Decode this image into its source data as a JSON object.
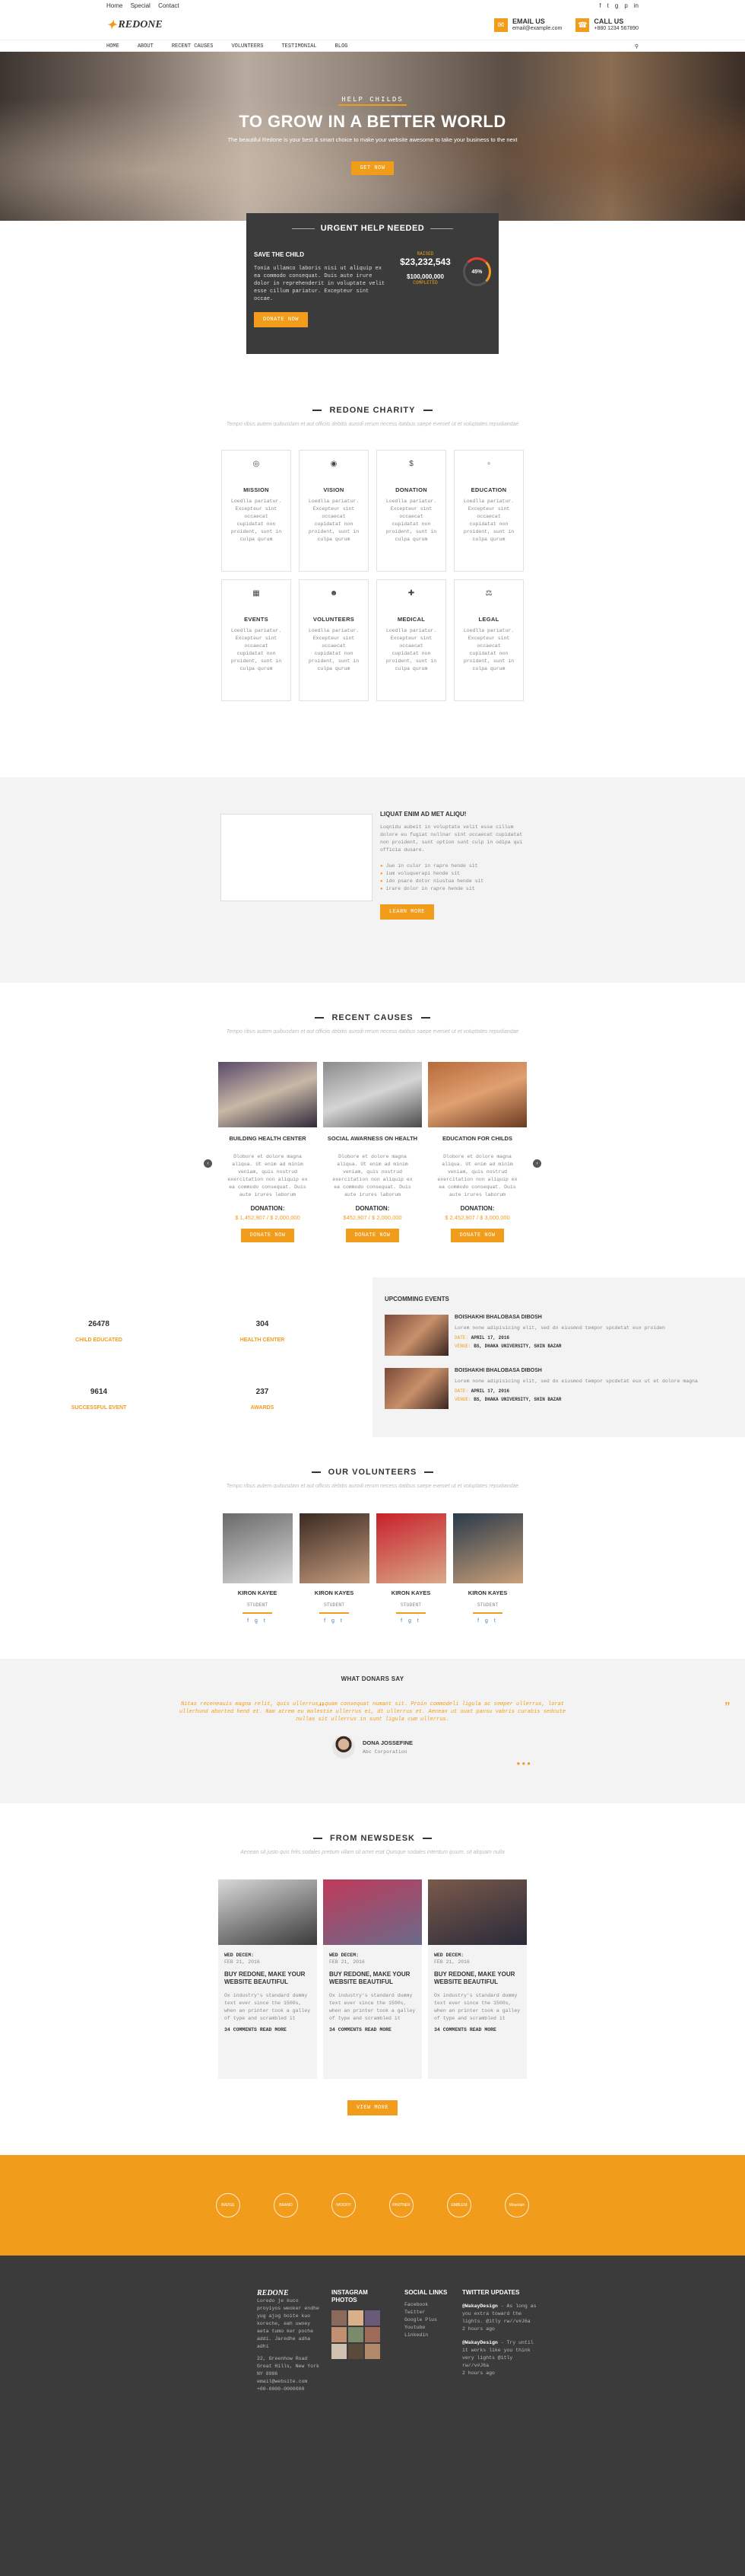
{
  "topbar": {
    "links": [
      "Home",
      "Special",
      "Contact"
    ],
    "social_icons": [
      "facebook-icon",
      "twitter-icon",
      "google-plus-icon",
      "pinterest-icon",
      "linkedin-icon"
    ]
  },
  "header": {
    "logo_text": "REDONE",
    "email_label": "EMAIL US",
    "email_value": "email@example.com",
    "call_label": "CALL US",
    "call_value": "+880 1234 567890"
  },
  "nav": {
    "items": [
      "HOME",
      "ABOUT",
      "RECENT CAUSES",
      "VOLUNTEERS",
      "TESTIMONIAL",
      "BLOG"
    ],
    "search_icon": "search-icon"
  },
  "hero": {
    "kicker": "HELP CHILDS",
    "title": "TO GROW IN A BETTER WORLD",
    "subtitle": "The beautiful Redone is your best & smart choice to make your website awesome to take your business to the next",
    "button": "GET NOW"
  },
  "urgent": {
    "title": "URGENT HELP NEEDED",
    "subject": "SAVE THE CHILD",
    "text": "Tonia ullamco laboris nisi ut aliquip ex ea commodo consequat. Duis aute irure dolor in reprehenderit in voluptate velit esse cillum pariatur. Excepteur sint occae.",
    "donate": "DONATE NOW",
    "raised_label": "RAISED",
    "raised": "$23,232,543",
    "goal": "$100,000,000",
    "goal_label": "COMPLETED",
    "progress_label": "45%",
    "progress": 0.45
  },
  "charity": {
    "title": "REDONE CHARITY",
    "subtitle": "Tempo ribus autem quibusdam et aut officiis debitis aurodi rerum necess itatibus saepe eveniet ut et voluptates repudiandae",
    "cards": [
      {
        "icon": "mission-icon",
        "title": "MISSION",
        "text": "Loedlla pariatur. Excepteur sint occaecat cupidatat non proident, sunt in culpa qurum"
      },
      {
        "icon": "eye-icon",
        "title": "VISION",
        "text": "Loedlla pariatur. Excepteur sint occaecat cupidatat non proident, sunt in culpa qurum"
      },
      {
        "icon": "dollar-icon",
        "title": "DONATION",
        "text": "Loedlla pariatur. Excepteur sint occaecat cupidatat non proident, sunt in culpa qurum"
      },
      {
        "icon": "education-icon",
        "title": "EDUCATION",
        "text": "Loedlla pariatur. Excepteur sint occaecat cupidatat non proident, sunt in culpa qurum"
      },
      {
        "icon": "calendar-icon",
        "title": "EVENTS",
        "text": "Loedlla pariatur. Excepteur sint occaecat cupidatat non proident, sunt in culpa qurum"
      },
      {
        "icon": "users-icon",
        "title": "VOLUNTEERS",
        "text": "Loedlla pariatur. Excepteur sint occaecat cupidatat non proident, sunt in culpa qurum"
      },
      {
        "icon": "medical-icon",
        "title": "MEDICAL",
        "text": "Loedlla pariatur. Excepteur sint occaecat cupidatat non proident, sunt in culpa qurum"
      },
      {
        "icon": "legal-icon",
        "title": "LEGAL",
        "text": "Loedlla pariatur. Excepteur sint occaecat cupidatat non proident, sunt in culpa qurum"
      }
    ]
  },
  "about": {
    "title": "LIQUAT ENIM AD MET ALIQU!",
    "text": "Loqnidu aubeit in voluptate velit esse cillum dolore eu fugiat nullnar sint occaecat cupidatat non proident, sunt option sunt culp in odipa qui officia dusare.",
    "bullets": [
      "Jue in culor in rapre hende sit",
      "ium voluquerapi hende sit",
      "ido psare dotor niustua hende sit",
      "irare dolor in rapre hende sit"
    ],
    "button": "LEARN MORE"
  },
  "causes": {
    "title": "RECENT CAUSES",
    "subtitle": "Tempo ribus autem quibusdam et aut officiis debitis aurodi rerum necess itatibus saepe eveniet ut et voluptates repudiandae",
    "items": [
      {
        "title": "BUILDING HEALTH CENTER",
        "text": "Dlobore et dolore magna aliqua. Ut enim ad minim veniam, quis nostrud exercitation non aliquip ex ea commodo consequat. Duis aute irures laborum",
        "donation_label": "DONATION:",
        "raised": "$ 1,452,907",
        "goal": "$ 2,000,000",
        "button": "DONATE NOW",
        "photo_colors": [
          "#5a4a6b",
          "#c9b8a6",
          "#2f2a3a"
        ]
      },
      {
        "title": "SOCIAL AWARNESS ON HEALTH",
        "text": "Dlobore et dolore magna aliqua. Ut enim ad minim veniam, quis nostrud exercitation non aliquip ex ea commodo consequat. Duis aute irures laborum",
        "donation_label": "DONATION:",
        "raised": "$452,907",
        "goal": "$ 2,000,000",
        "button": "DONATE NOW",
        "photo_colors": [
          "#8a8a8a",
          "#d5d5d5",
          "#4a4a4a"
        ]
      },
      {
        "title": "EDUCATION FOR CHILDS",
        "text": "Dlobore et dolore magna aliqua. Ut enim ad minim veniam, quis nostrud exercitation non aliquip ex ea commodo consequat. Duis aute irures laborum",
        "donation_label": "DONATION:",
        "raised": "$ 2,452,907",
        "goal": "$ 3,000,000",
        "button": "DONATE NOW",
        "photo_colors": [
          "#b86a3a",
          "#e0a070",
          "#6a3a20"
        ]
      }
    ]
  },
  "stats": [
    {
      "value": "26478",
      "label": "CHILD EDUCATED"
    },
    {
      "value": "304",
      "label": "HEALTH CENTER"
    },
    {
      "value": "9614",
      "label": "SUCCESSFUL EVENT"
    },
    {
      "value": "237",
      "label": "AWARDS"
    }
  ],
  "events": {
    "title": "UPCOMMING EVENTS",
    "items": [
      {
        "title": "BOISHAKHI BHALOBASA DIBOSH",
        "text": "Lorem none adipisicing elit, sed do eiusmod tempor spcdetat eux proiden",
        "date_label": "DATE:",
        "date": "APRIL 17, 2016",
        "venue_label": "VENUE:",
        "venue": "BS, DHAKA UNIVERSITY, SHIN BAZAR"
      },
      {
        "title": "BOISHAKHI BHALOBASA DIBOSH",
        "text": "Lorem none adipisicing elit, sed do eiusmod tempor spcdetat eux ut et dolore magna",
        "date_label": "DATE:",
        "date": "APRIL 17, 2016",
        "venue_label": "VENUE:",
        "venue": "BS, DHAKA UNIVERSITY, SHIN BAZAR"
      }
    ]
  },
  "volunteers": {
    "title": "OUR VOLUNTEERS",
    "subtitle": "Tempo ribus autem quibusdam et aut officiis debitis aurodi rerum necess itatibus saepe eveniet ut et voluptates repudiandae",
    "items": [
      {
        "name": "KIRON KAYEE",
        "role": "STUDENT",
        "photo_colors": [
          "#6a6a6a",
          "#d9d9d9"
        ]
      },
      {
        "name": "KIRON KAYES",
        "role": "STUDENT",
        "photo_colors": [
          "#3a2a22",
          "#c79d7f"
        ]
      },
      {
        "name": "KIRON KAYES",
        "role": "STUDENT",
        "photo_colors": [
          "#c8202a",
          "#d9a98a"
        ]
      },
      {
        "name": "KIRON KAYES",
        "role": "STUDENT",
        "photo_colors": [
          "#2a3a4a",
          "#c9a07a"
        ]
      }
    ],
    "social": "f g t"
  },
  "donors": {
    "title": "WHAT DONARS SAY",
    "quote": "Nitas receneauis magna relit, quis ullerrus, quam consequat numant sit. Proin commodeli ligula ac semper ullerrus, lorat ullerhund aborted hend et. Nam atrem eu molestie ullerrus ei, dt ullerrus et. Aenean ut ouat pansu vabris curabis sedcute nullas sit ullerrus in sunt ligula cum ullerrus.",
    "name": "DONA JOSSEFINE",
    "company": "Abc Corporation"
  },
  "news": {
    "title": "FROM NEWSDESK",
    "subtitle": "Aenean sit justo quis felis sodales pretium ullam sit amet erat Quisque sodales interdum ipsum, sit aliquam nulla",
    "items": [
      {
        "date1": "WED DECEM:",
        "date2": "FEB 21, 2016",
        "title": "BUY REDONE, MAKE YOUR WEBSITE BEAUTIFUL",
        "text": "Ox industry's standard dummy text ever since the 1500s, when an printer took a galley of type and scrambled it",
        "comments": "34",
        "comments_label": "COMMENTS",
        "read_more": "READ MORE",
        "photo_colors": [
          "#d9d9d9",
          "#3a3a3a"
        ]
      },
      {
        "date1": "WED DECEM:",
        "date2": "FEB 21, 2016",
        "title": "BUY REDONE, MAKE YOUR WEBSITE BEAUTIFUL",
        "text": "Ox industry's standard dummy text ever since the 1500s, when an printer took a galley of type and scrambled it",
        "comments": "34",
        "comments_label": "COMMENTS",
        "read_more": "READ MORE",
        "photo_colors": [
          "#c03a5a",
          "#6a6a8a"
        ]
      },
      {
        "date1": "WED DECEM:",
        "date2": "FEB 21, 2016",
        "title": "BUY REDONE, MAKE YOUR WEBSITE BEAUTIFUL",
        "text": "Ox industry's standard dummy text ever since the 1500s, when an printer took a galley of type and scrambled it",
        "comments": "34",
        "comments_label": "COMMENTS",
        "read_more": "READ MORE",
        "photo_colors": [
          "#7a5a4a",
          "#2a2a3a"
        ]
      }
    ],
    "button": "VIEW MORE"
  },
  "partners": [
    "BADGE",
    "BRAND",
    "WOODY",
    "PARTNER",
    "EMBLEM",
    "Mountain"
  ],
  "footer": {
    "logo": "REDONE",
    "about": "Loredo je kuco proyiyos weoker endhe yug ajog boite kuo koreche, eah uwoey aeta tumo ker poche addi. Jaredhe adha adhi",
    "address": "22, Greenhow Road Great Hills, New York NY 8986",
    "email": "email@website.com",
    "phone": "+00-0000-0000000",
    "insta_title": "INSTAGRAM PHOTOS",
    "insta_colors": [
      "#8a6a5a",
      "#d9b08a",
      "#6a5a7a",
      "#c09070",
      "#7a8a6a",
      "#a06a5a",
      "#d0c0b0",
      "#5a4a3a",
      "#b08a6a"
    ],
    "social_title": "SOCIAL LINKS",
    "social": [
      "Facebook",
      "Twitter",
      "Google Plus",
      "Youtube",
      "Linkedin"
    ],
    "twitter_title": "TWITTER UPDATES",
    "tweets": [
      {
        "handle": "@WakayDesign",
        "text": "- As long as you extra toward the lights. @itly rw//v#J6a",
        "time": "2 hours ago"
      },
      {
        "handle": "@WakayDesign",
        "text": "- Try until it works like you think very lights @itly rw//v#J6a",
        "time": "2 hours ago"
      }
    ]
  },
  "colors": {
    "accent": "#f29c1c",
    "dark": "#3b3b3b",
    "light": "#f3f3f3"
  }
}
